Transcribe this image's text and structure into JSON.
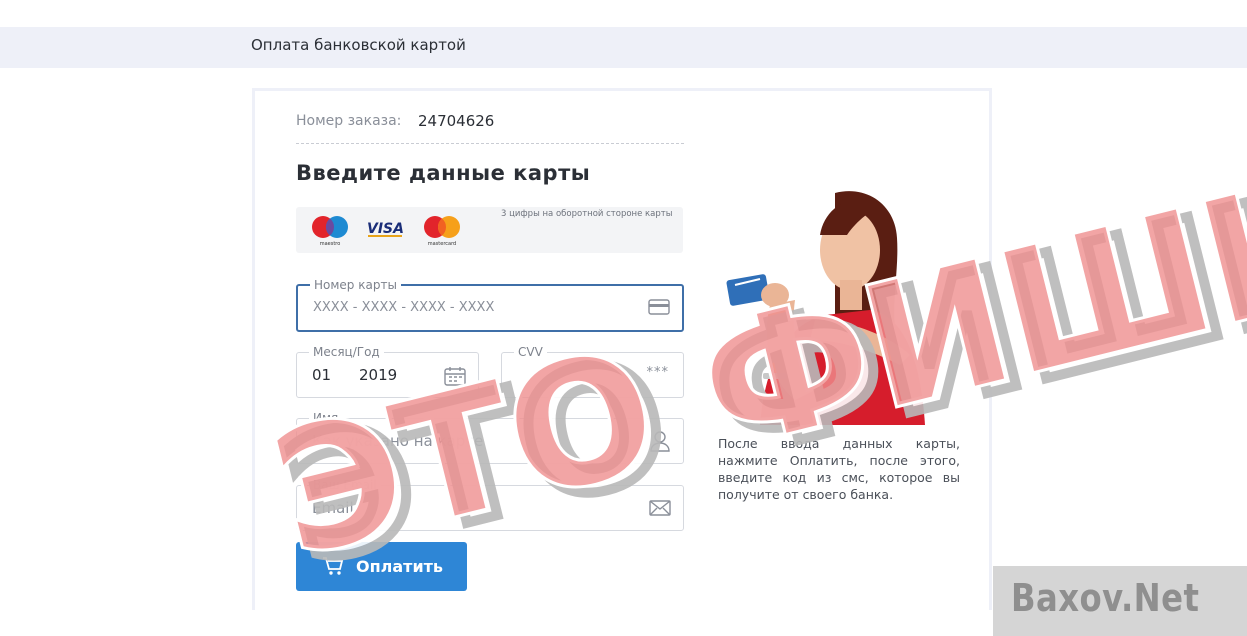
{
  "header": {
    "title": "Оплата банковской картой"
  },
  "order": {
    "label": "Номер заказа:",
    "number": "24704626"
  },
  "form": {
    "title": "Введите данные карты",
    "card_logos": [
      {
        "name": "maestro",
        "caption": "maestro"
      },
      {
        "name": "visa",
        "caption": "VISA"
      },
      {
        "name": "mastercard",
        "caption": "mastercard"
      }
    ],
    "card_number": {
      "label": "Номер карты",
      "placeholder": "XXXX - XXXX - XXXX - XXXX",
      "icon": "card-icon"
    },
    "expiry": {
      "label": "Месяц/Год",
      "month": "01",
      "year": "2019",
      "icon": "calendar-icon"
    },
    "cvv": {
      "label": "CVV",
      "placeholder": "***",
      "hint": "3 цифры на оборотной стороне карты"
    },
    "name": {
      "label": "Имя",
      "placeholder": "Как указано на карте",
      "icon": "user-icon"
    },
    "email": {
      "label": "Ваш Email",
      "placeholder": "Email",
      "icon": "envelope-icon"
    },
    "submit": {
      "label": "Оплатить",
      "icon": "cart-icon"
    }
  },
  "info_text": "После ввода данных карты, нажмите Оплатить, после этого, введите код из смс, которое вы получите от своего банка.",
  "watermark": {
    "text": "ЭТО ФИШИНГ",
    "site": "Baxov.Net"
  },
  "colors": {
    "accent": "#2e86d6",
    "active_border": "#3f6fa8",
    "topbar": "#eef0f8",
    "watermark_red": "#e87a7a"
  }
}
